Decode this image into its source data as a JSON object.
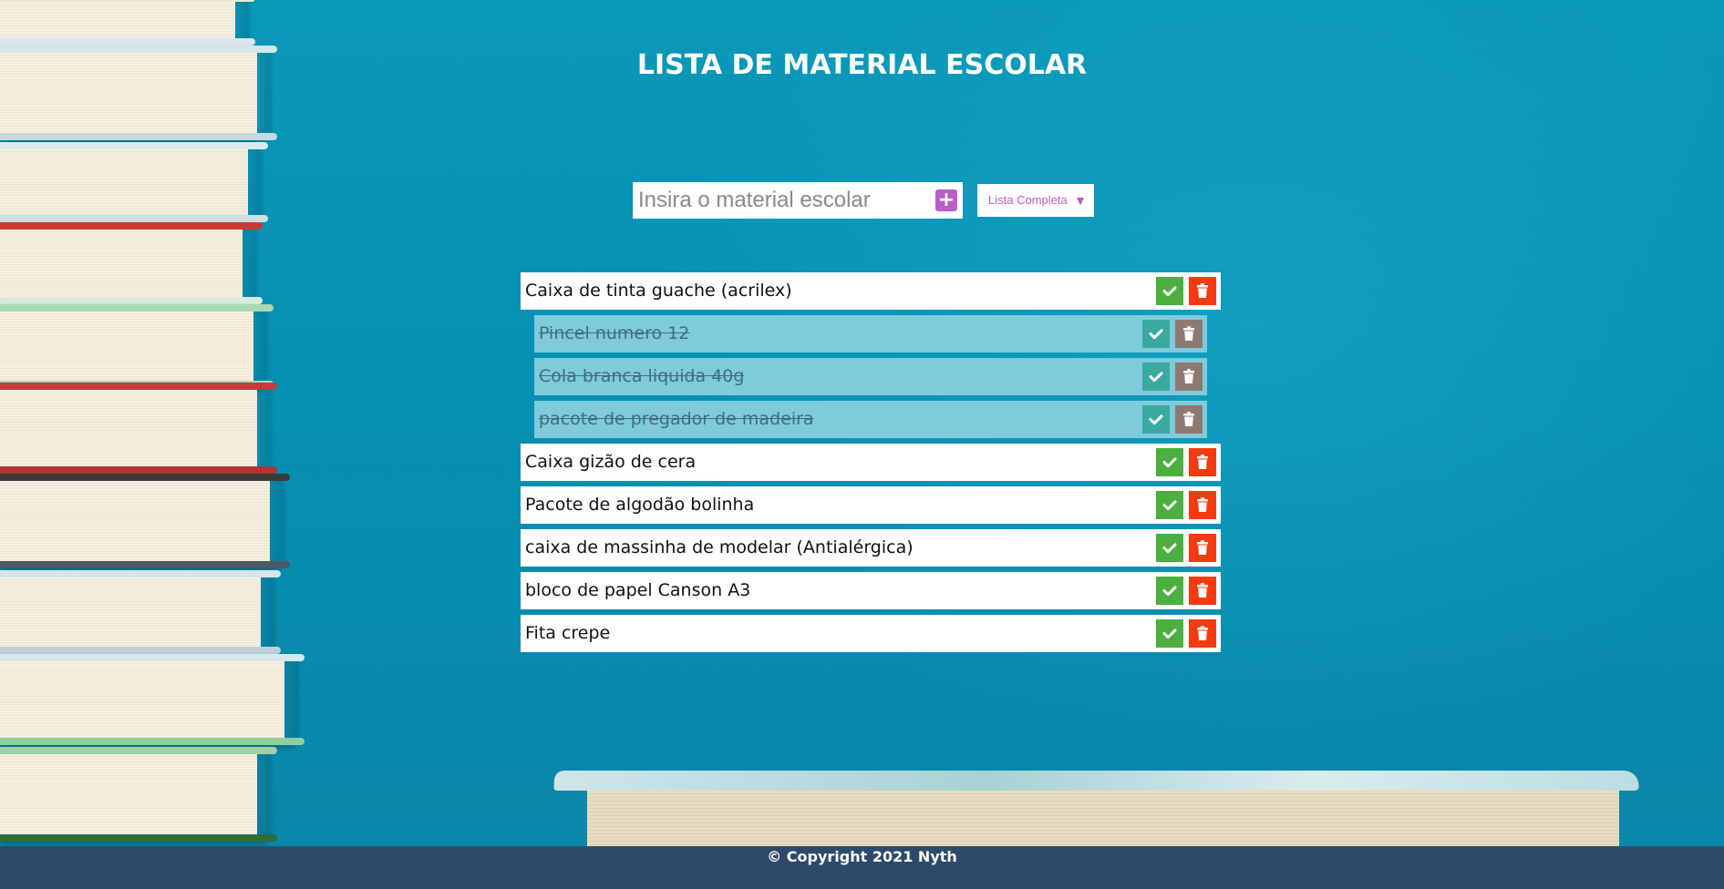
{
  "page": {
    "title": "LISTA DE MATERIAL ESCOLAR"
  },
  "form": {
    "input_placeholder": "Insira o material escolar",
    "input_value": "",
    "add_icon": "plus-square-icon",
    "filter": {
      "selected": "Lista Completa",
      "caret_icon": "caret-down-icon"
    }
  },
  "items": [
    {
      "text": "Caixa de tinta guache (acrilex)",
      "completed": false
    },
    {
      "text": "Pincel numero 12",
      "completed": true
    },
    {
      "text": "Cola branca liquida 40g",
      "completed": true
    },
    {
      "text": "pacote de pregador de madeira",
      "completed": true
    },
    {
      "text": "Caixa gizão de cera",
      "completed": false
    },
    {
      "text": "Pacote de algodão bolinha",
      "completed": false
    },
    {
      "text": "caixa de massinha de modelar (Antialérgica)",
      "completed": false
    },
    {
      "text": "bloco de papel Canson A3",
      "completed": false
    },
    {
      "text": "Fita crepe",
      "completed": false
    }
  ],
  "item_actions": {
    "check_icon": "check-icon",
    "delete_icon": "trash-icon"
  },
  "footer": {
    "copyright": "© Copyright 2021 Nyth"
  },
  "colors": {
    "background": "#0a98b8",
    "accent": "#b560c4",
    "check": "#4caf3f",
    "delete": "#f43b0f",
    "completed_bg": "#7fcbdc",
    "footer_bg": "#2d4a6b"
  }
}
